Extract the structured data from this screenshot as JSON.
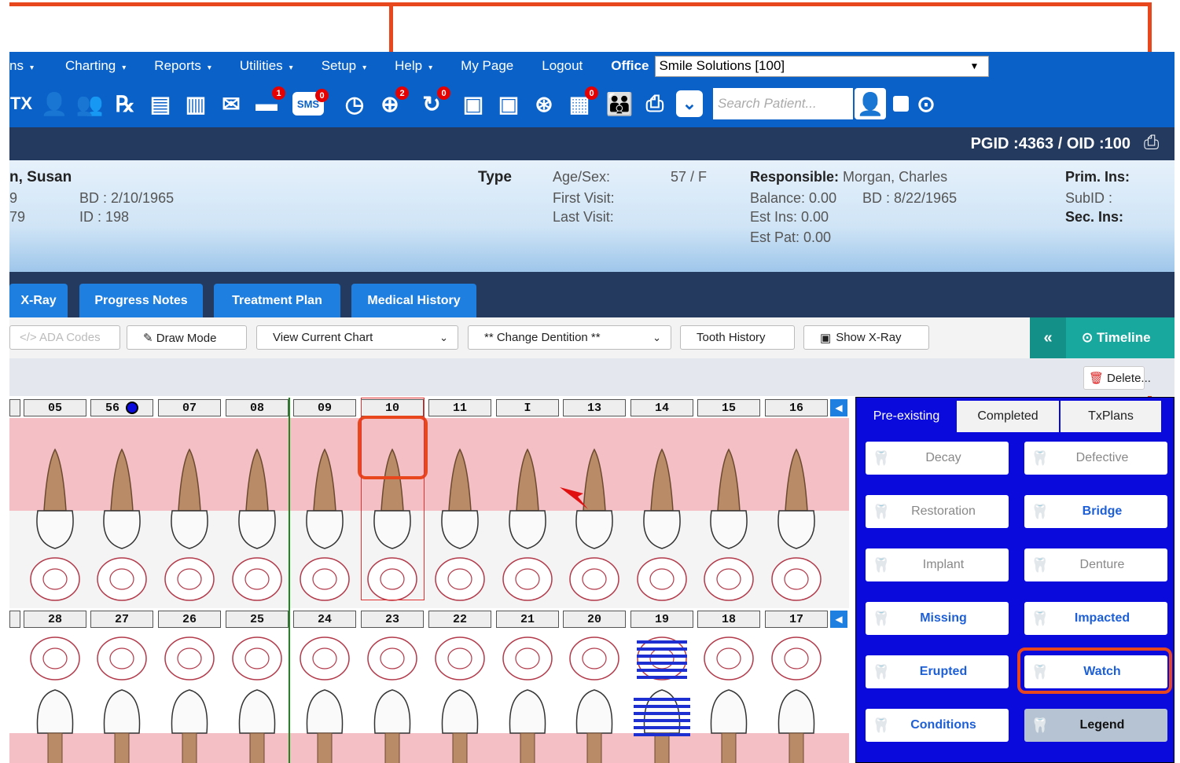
{
  "menu": {
    "items": [
      "ns",
      "Charting",
      "Reports",
      "Utilities",
      "Setup",
      "Help"
    ],
    "my_page": "My Page",
    "logout": "Logout",
    "office_label": "Office",
    "office_value": "Smile Solutions [100]"
  },
  "toolbar": {
    "search_placeholder": "Search Patient...",
    "badges": {
      "tx": "TX",
      "msg": "1",
      "sms": "SMS",
      "sms_count": "0",
      "globe": "2",
      "recall": "0",
      "docs": "0"
    }
  },
  "header": {
    "pgid": "PGID :4363  /  OID :100"
  },
  "patient": {
    "name": "n, Susan",
    "left1": "9",
    "left2": "79",
    "bd": "BD : 2/10/1965",
    "id": "ID : 198",
    "type_label": "Type",
    "age_label": "Age/Sex:",
    "age_value": "57 / F",
    "first_visit": "First Visit:",
    "last_visit": "Last Visit:",
    "responsible_label": "Responsible:",
    "responsible_value": "Morgan, Charles",
    "balance": "Balance: 0.00",
    "resp_bd": "BD : 8/22/1965",
    "est_ins": "Est Ins:  0.00",
    "est_pat": "Est Pat: 0.00",
    "prim_ins": "Prim. Ins:",
    "subid": "SubID :",
    "sec_ins": "Sec. Ins:"
  },
  "tabs": [
    "X-Ray",
    "Progress Notes",
    "Treatment Plan",
    "Medical History"
  ],
  "controls": {
    "ada": "</> ADA Codes",
    "draw": "✎ Draw Mode",
    "view": "View Current Chart",
    "dentition": "** Change Dentition **",
    "tooth_history": "Tooth History",
    "show_xray": "Show X-Ray",
    "collapse": "«",
    "timeline": "⊙ Timeline",
    "delete": "Delete..."
  },
  "upper_numbers": [
    "05",
    "56",
    "07",
    "08",
    "09",
    "10",
    "11",
    "I",
    "13",
    "14",
    "15",
    "16"
  ],
  "lower_numbers": [
    "28",
    "27",
    "26",
    "25",
    "24",
    "23",
    "22",
    "21",
    "20",
    "19",
    "18",
    "17"
  ],
  "right_panel": {
    "tabs": [
      "Pre-existing",
      "Completed",
      "TxPlans"
    ],
    "buttons": [
      {
        "label": "Decay",
        "icon": "tooth-icon",
        "active": false
      },
      {
        "label": "Defective",
        "icon": "tooth-icon",
        "active": false
      },
      {
        "label": "Restoration",
        "icon": "tooth-icon",
        "active": false
      },
      {
        "label": "Bridge",
        "icon": "bridge-icon",
        "active": true
      },
      {
        "label": "Implant",
        "icon": "implant-icon",
        "active": false
      },
      {
        "label": "Denture",
        "icon": "denture-icon",
        "active": false
      },
      {
        "label": "Missing",
        "icon": "missing-icon",
        "active": true
      },
      {
        "label": "Impacted",
        "icon": "impacted-icon",
        "active": true
      },
      {
        "label": "Erupted",
        "icon": "erupted-icon",
        "active": true
      },
      {
        "label": "Watch",
        "icon": "watch-icon",
        "active": true
      },
      {
        "label": "Conditions",
        "icon": "conditions-icon",
        "active": true
      },
      {
        "label": "Legend",
        "icon": "legend-icon",
        "active": false
      }
    ]
  },
  "colors": {
    "menu_blue": "#0a62c9",
    "dark_navy": "#243a5e",
    "panel_blue": "#0a0adc",
    "annotation": "#e8471e",
    "timeline": "#19a89e",
    "gum_pink": "#f5bfc6"
  }
}
